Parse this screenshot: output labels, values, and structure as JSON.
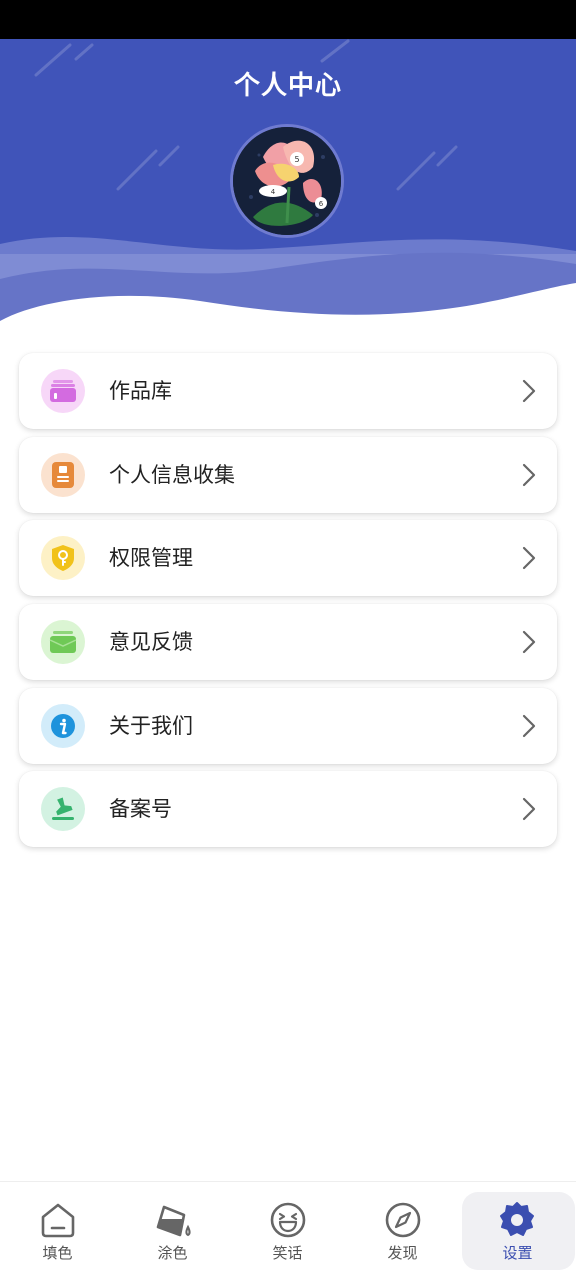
{
  "header": {
    "title": "个人中心"
  },
  "menu": {
    "items": [
      {
        "label": "作品库",
        "icon": "gallery-box-icon",
        "color": "#d36be0",
        "bg": "#f7d7f8"
      },
      {
        "label": "个人信息收集",
        "icon": "profile-document-icon",
        "color": "#e6893a",
        "bg": "#fbe2cf"
      },
      {
        "label": "权限管理",
        "icon": "shield-key-icon",
        "color": "#f1c21a",
        "bg": "#fdf1c6"
      },
      {
        "label": "意见反馈",
        "icon": "feedback-mail-icon",
        "color": "#6fc956",
        "bg": "#dbf5d3"
      },
      {
        "label": "关于我们",
        "icon": "info-icon",
        "color": "#1e93dc",
        "bg": "#d2ecfa"
      },
      {
        "label": "备案号",
        "icon": "stamp-icon",
        "color": "#36b36e",
        "bg": "#d3f2e2"
      }
    ]
  },
  "tabbar": {
    "tabs": [
      {
        "label": "填色",
        "icon": "home-icon"
      },
      {
        "label": "涂色",
        "icon": "paint-bucket-icon"
      },
      {
        "label": "笑话",
        "icon": "laugh-face-icon"
      },
      {
        "label": "发现",
        "icon": "compass-icon"
      },
      {
        "label": "设置",
        "icon": "gear-icon",
        "active": true
      }
    ]
  },
  "colors": {
    "header_blue": "#4054b9",
    "active_tab": "#3b4eb0"
  }
}
